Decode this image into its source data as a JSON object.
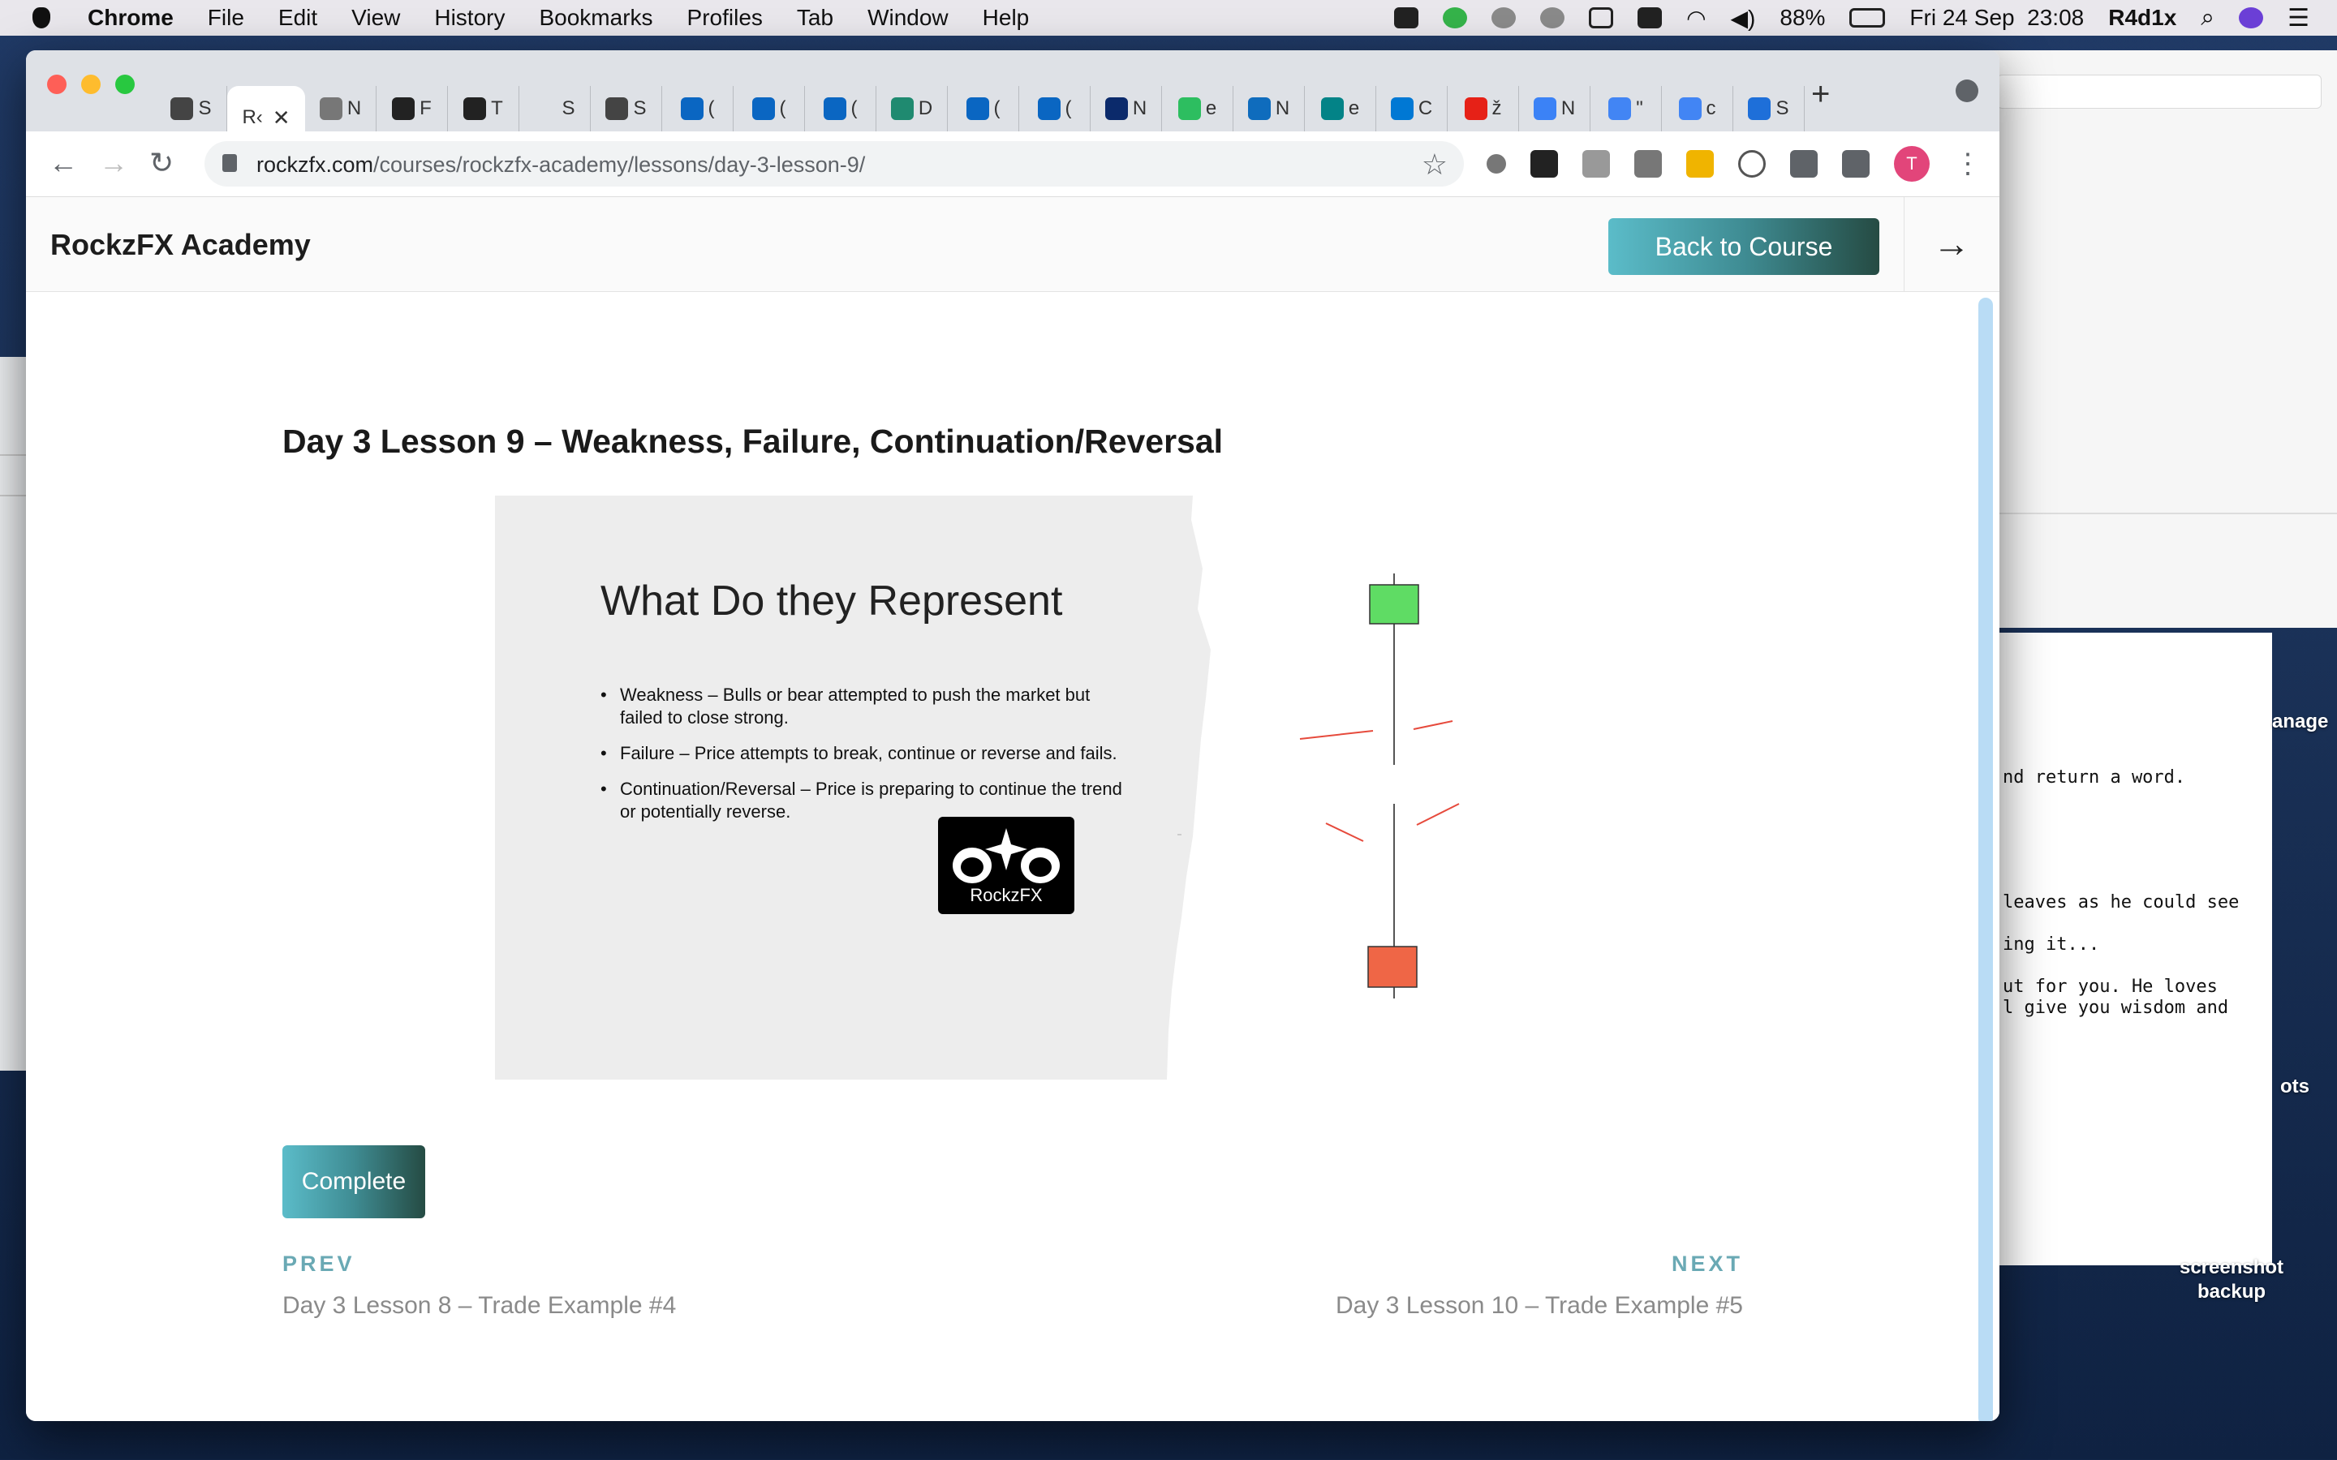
{
  "menubar": {
    "app": "Chrome",
    "items": [
      "File",
      "Edit",
      "View",
      "History",
      "Bookmarks",
      "Profiles",
      "Tab",
      "Window",
      "Help"
    ],
    "battery": "88%",
    "datetime": "Fri 24 Sep  23:08",
    "user": "R4d1x"
  },
  "background": {
    "terminal_lines": [
      "nd return a word.",
      "leaves as he could see",
      "ing it...",
      "ut for you. He loves",
      "l give you wisdom and"
    ],
    "desktop_labels": [
      "anage",
      "ots",
      "screenshot\nbackup"
    ]
  },
  "browser": {
    "tabs": [
      {
        "label": "S",
        "icon": "globe-icon",
        "color": "#444"
      },
      {
        "label": "R‹",
        "icon": "",
        "color": "#fff",
        "active": true
      },
      {
        "label": "N",
        "icon": "script-b-icon",
        "color": "#777"
      },
      {
        "label": "F",
        "icon": "info-i-icon",
        "color": "#222"
      },
      {
        "label": "T",
        "icon": "info-i-icon",
        "color": "#222"
      },
      {
        "label": "S",
        "icon": "blank-icon",
        "color": "transparent"
      },
      {
        "label": "S",
        "icon": "globe-icon",
        "color": "#444"
      },
      {
        "label": "(",
        "icon": "linkedin-icon",
        "color": "#0a66c2"
      },
      {
        "label": "(",
        "icon": "linkedin-icon",
        "color": "#0a66c2"
      },
      {
        "label": "(",
        "icon": "linkedin-icon",
        "color": "#0a66c2"
      },
      {
        "label": "D",
        "icon": "dollar-icon",
        "color": "#1f8a70"
      },
      {
        "label": "(",
        "icon": "linkedin-icon",
        "color": "#0a66c2"
      },
      {
        "label": "(",
        "icon": "linkedin-icon",
        "color": "#0a66c2"
      },
      {
        "label": "N",
        "icon": "circle-o-icon",
        "color": "#0b2a6b"
      },
      {
        "label": "e",
        "icon": "evernote-icon",
        "color": "#2dbe60"
      },
      {
        "label": "N",
        "icon": "outlook-icon",
        "color": "#0f6cbd"
      },
      {
        "label": "e",
        "icon": "sharepoint-icon",
        "color": "#038387"
      },
      {
        "label": "C",
        "icon": "windows-icon",
        "color": "#0078d4"
      },
      {
        "label": "ž",
        "icon": "youtube-icon",
        "color": "#e62117"
      },
      {
        "label": "N",
        "icon": "ring-icon",
        "color": "#3b82f6"
      },
      {
        "label": "\"",
        "icon": "google-icon",
        "color": "#4285f4"
      },
      {
        "label": "c",
        "icon": "google-icon",
        "color": "#4285f4"
      },
      {
        "label": "S",
        "icon": "cube-icon",
        "color": "#1e6fd9"
      }
    ],
    "url_host": "rockzfx.com",
    "url_path": "/courses/rockzfx-academy/lessons/day-3-lesson-9/",
    "profile_initial": "T"
  },
  "page": {
    "brand": "RockzFX Academy",
    "back_button": "Back to Course",
    "lesson_title": "Day 3 Lesson 9 – Weakness, Failure, Continuation/Reversal",
    "slide": {
      "heading": "What Do they Represent",
      "bullets": [
        "Weakness – Bulls or bear attempted to push the market but failed to close strong.",
        "Failure – Price attempts to break, continue or reverse and fails.",
        "Continuation/Reversal – Price is preparing to continue the trend or potentially reverse."
      ],
      "logo_text": "RockzFX",
      "colors": {
        "bull": "#5fdc64",
        "bear": "#ef6646",
        "arrow": "#e64a3c"
      }
    },
    "complete_button": "Complete",
    "prev": {
      "label": "PREV",
      "title": "Day 3 Lesson 8 – Trade Example #4"
    },
    "next": {
      "label": "NEXT",
      "title": "Day 3 Lesson 10 – Trade Example #5"
    }
  }
}
